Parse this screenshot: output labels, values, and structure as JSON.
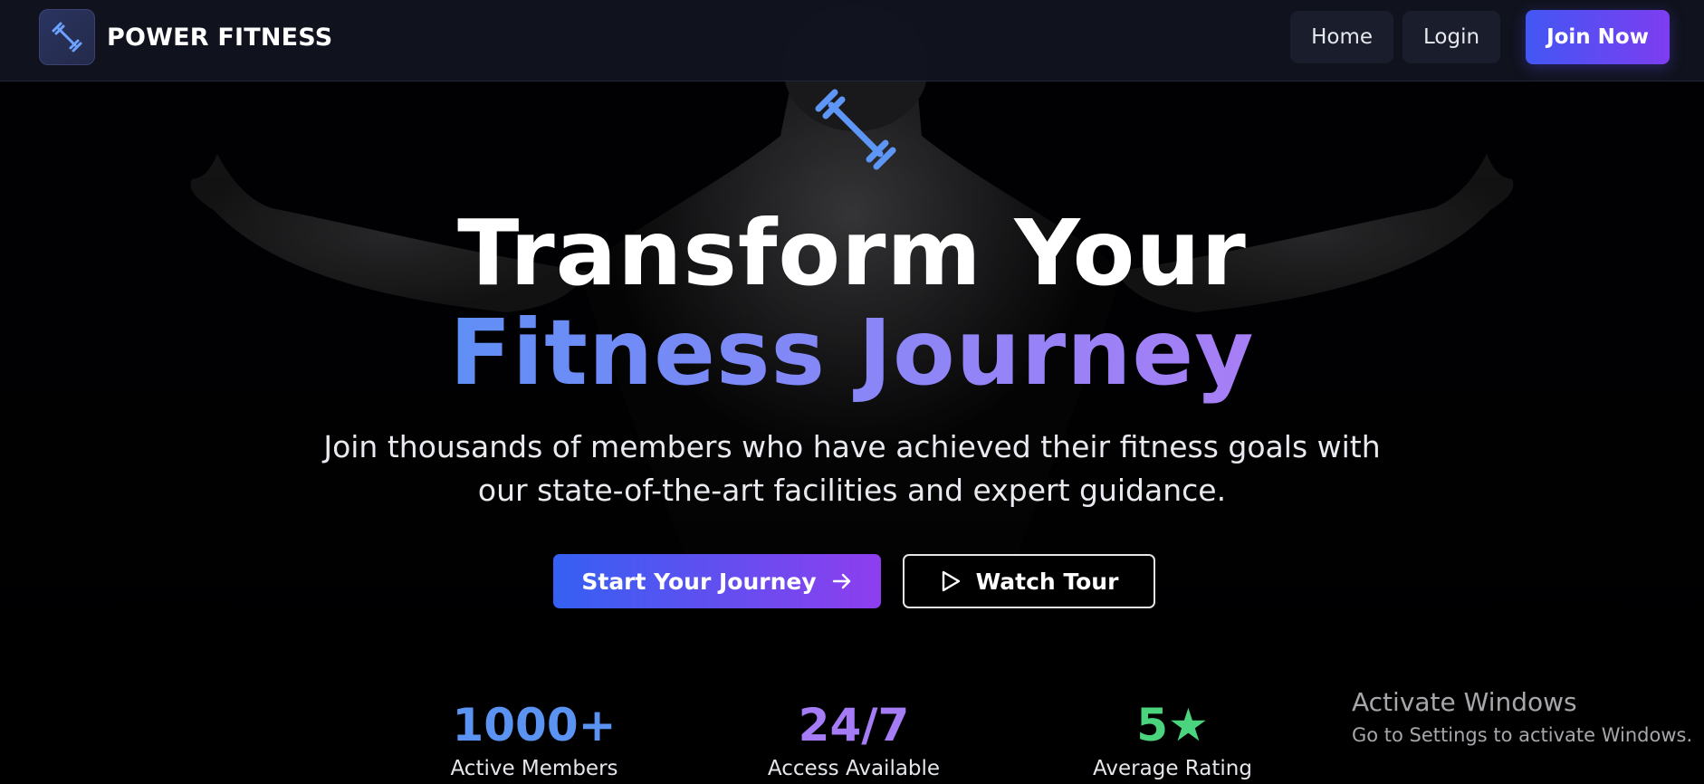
{
  "brand": {
    "name": "POWER FITNESS",
    "logo_icon": "dumbbell-icon"
  },
  "nav": {
    "home_label": "Home",
    "login_label": "Login",
    "join_label": "Join Now"
  },
  "hero": {
    "icon": "dumbbell-icon",
    "title_line1": "Transform Your",
    "title_line2": "Fitness Journey",
    "subtitle_line1": "Join thousands of members who have achieved their fitness goals with",
    "subtitle_line2": "our state-of-the-art facilities and expert guidance.",
    "primary_cta": "Start Your Journey",
    "primary_cta_icon": "arrow-right-icon",
    "secondary_cta": "Watch Tour",
    "secondary_cta_icon": "play-icon"
  },
  "stats": [
    {
      "value": "1000+",
      "label": "Active Members",
      "color": "#5b93f2"
    },
    {
      "value": "24/7",
      "label": "Access Available",
      "color": "#a57cf6"
    },
    {
      "value": "5★",
      "label": "Average Rating",
      "color": "#4ad47d"
    }
  ],
  "watermark": {
    "title": "Activate Windows",
    "subtitle": "Go to Settings to activate Windows."
  },
  "colors": {
    "accent_blue": "#4257f3",
    "accent_purple": "#7d3df0",
    "nav_bg": "#11141f"
  }
}
